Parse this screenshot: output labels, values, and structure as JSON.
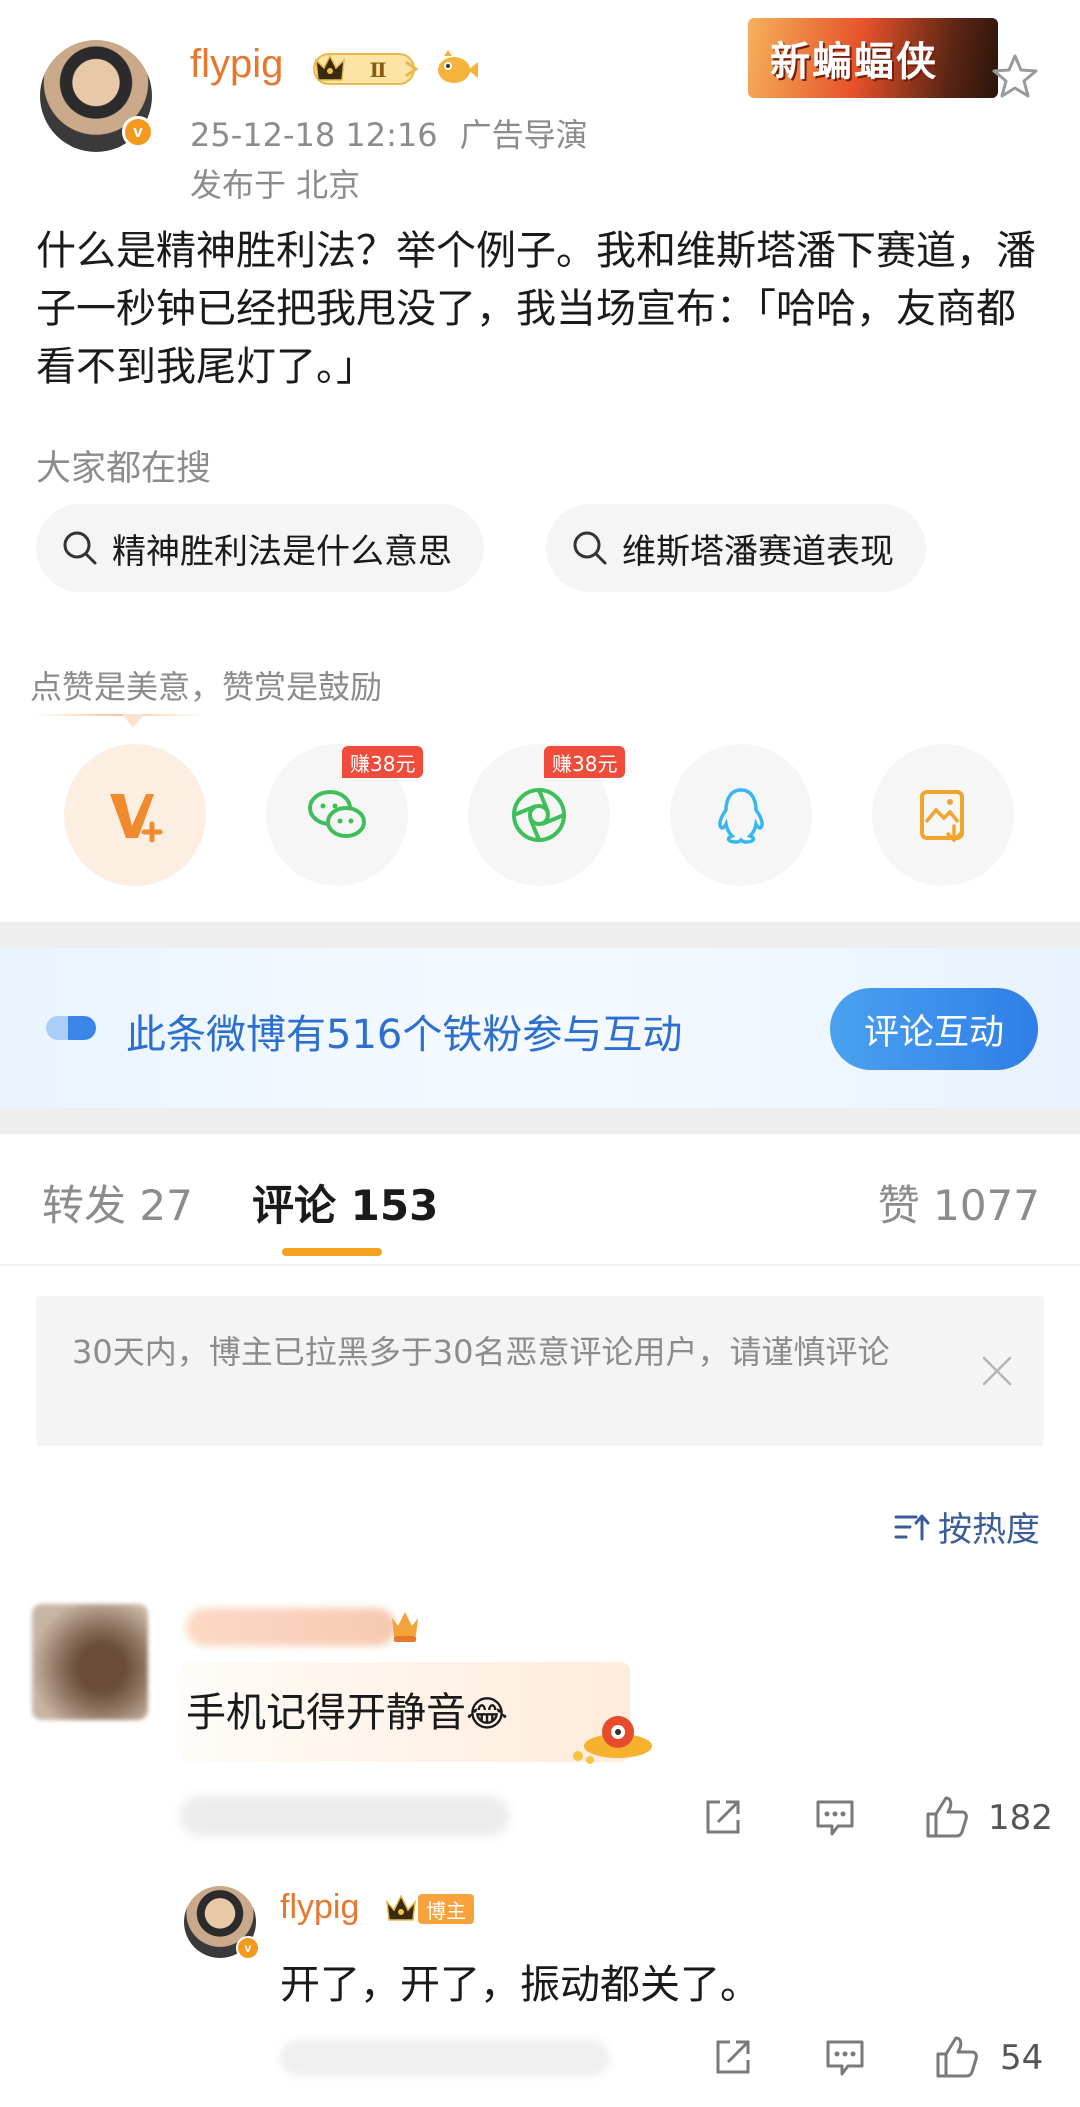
{
  "post": {
    "author": "flypig",
    "level": "Ⅱ",
    "verified_mark": "v",
    "date": "25-12-18 12:16",
    "source": "广告导演",
    "location": "发布于 北京",
    "sticker_text": "新蝙蝠侠",
    "text": "什么是精神胜利法？举个例子。我和维斯塔潘下赛道，潘子一秒钟已经把我甩没了，我当场宣布：「哈哈，友商都看不到我尾灯了。」"
  },
  "search": {
    "title": "大家都在搜",
    "chips": [
      "精神胜利法是什么意思",
      "维斯塔潘赛道表现"
    ]
  },
  "reward": {
    "tip": "点赞是美意，赞赏是鼓励",
    "earn_badge": "赚38元",
    "icons": [
      "v-plus-icon",
      "wechat-icon",
      "moments-icon",
      "qq-icon",
      "save-image-icon"
    ]
  },
  "banner": {
    "text": "此条微博有516个铁粉参与互动",
    "button": "评论互动"
  },
  "tabs": {
    "forward": "转发 27",
    "comment": "评论 153",
    "like": "赞 1077"
  },
  "notice": {
    "text": "30天内，博主已拉黑多于30名恶意评论用户，请谨慎评论"
  },
  "sort": {
    "label": "按热度"
  },
  "comments": [
    {
      "text": "手机记得开静音",
      "emoji": "😂",
      "likes": "182"
    }
  ],
  "reply": {
    "author": "flypig",
    "tag": "博主",
    "text": "开了，开了，振动都关了。",
    "likes": "54"
  },
  "colors": {
    "accent_orange": "#e8772e",
    "link_blue": "#2c6fd1",
    "tab_underline": "#f5a21d"
  }
}
